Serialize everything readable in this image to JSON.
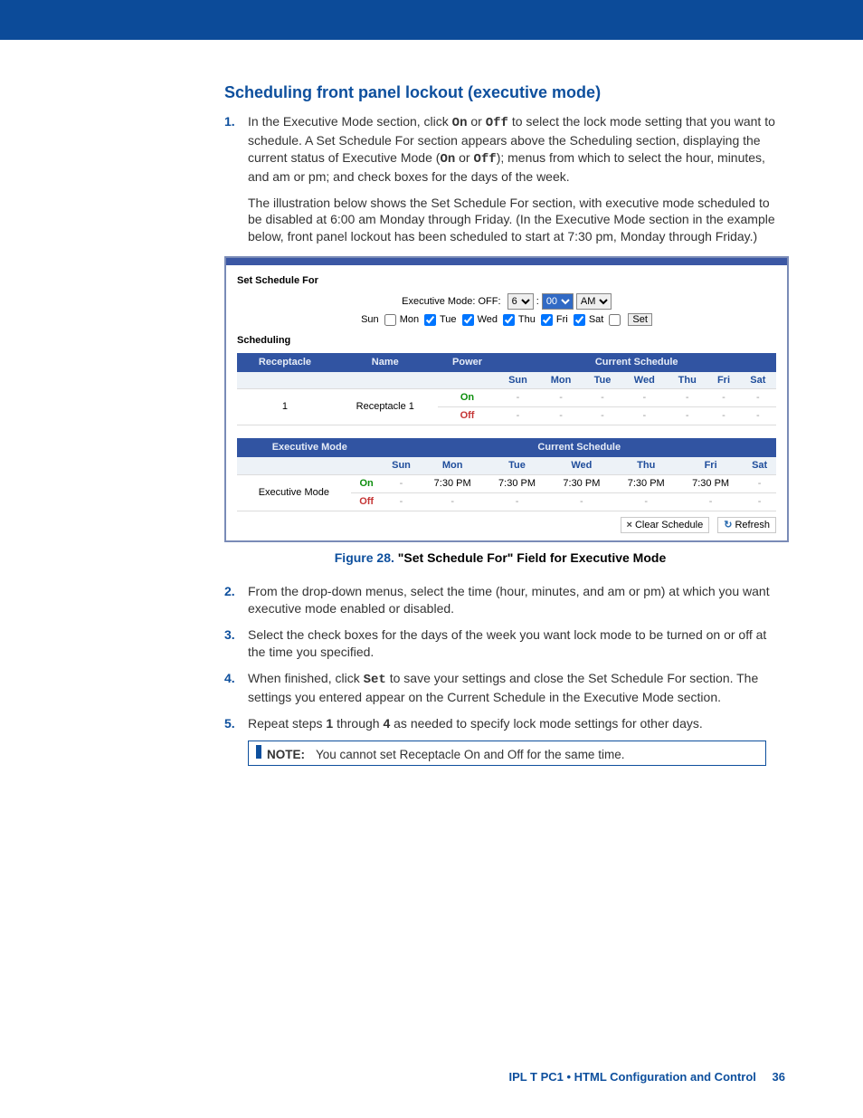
{
  "heading": "Scheduling front panel lockout (executive mode)",
  "steps": {
    "s1a": "In the Executive Mode section, click ",
    "s1_on": "On",
    "s1_mid": " or ",
    "s1_off": "Off",
    "s1b": " to select the lock mode setting that you want to schedule. A Set Schedule For section appears above the Scheduling section, displaying the current status of Executive Mode (",
    "s1_on2": "On",
    "s1_mid2": " or ",
    "s1_off2": "Off",
    "s1c": "); menus from which to select the hour, minutes, and am or pm; and check boxes for the days of the week.",
    "s1p2": "The illustration below shows the Set Schedule For section, with executive mode scheduled to be disabled at 6:00 am Monday through Friday. (In the Executive Mode section in the example below, front panel lockout has been scheduled to start at 7:30 pm, Monday through Friday.)",
    "s2": "From the drop-down menus, select the time (hour, minutes, and am or pm) at which you want executive mode enabled or disabled.",
    "s3": "Select the check boxes for the days of the week you want lock mode to be turned on or off at the time you specified.",
    "s4a": "When finished, click ",
    "s4_set": "Set",
    "s4b": " to save your settings and close the Set Schedule For section. The settings you entered appear on the Current Schedule in the Executive Mode section.",
    "s5a": "Repeat steps ",
    "s5_1": "1",
    "s5_mid": " through ",
    "s5_4": "4",
    "s5b": " as needed to specify lock mode settings for other days."
  },
  "shot": {
    "set_schedule_for": "Set Schedule For",
    "exec_mode_label": "Executive Mode: OFF:",
    "hour": "6",
    "colon": ":",
    "min": "00",
    "ampm": "AM",
    "days": [
      "Sun",
      "Mon",
      "Tue",
      "Wed",
      "Thu",
      "Fri",
      "Sat"
    ],
    "checked": [
      false,
      true,
      true,
      true,
      true,
      true,
      false
    ],
    "set": "Set",
    "scheduling": "Scheduling",
    "hdr_receptacle": "Receptacle",
    "hdr_name": "Name",
    "hdr_power": "Power",
    "hdr_cur": "Current Schedule",
    "daycols": [
      "Sun",
      "Mon",
      "Tue",
      "Wed",
      "Thu",
      "Fri",
      "Sat"
    ],
    "rec_num": "1",
    "rec_name": "Receptacle 1",
    "on": "On",
    "off": "Off",
    "exec_hdr": "Executive Mode",
    "exec_row": "Executive Mode",
    "on_times": [
      "-",
      "7:30 PM",
      "7:30 PM",
      "7:30 PM",
      "7:30 PM",
      "7:30 PM",
      "-"
    ],
    "clear": "Clear Schedule",
    "refresh": "Refresh"
  },
  "figure": {
    "lead": "Figure 28.",
    "rest": "  \"Set Schedule For\" Field for Executive Mode"
  },
  "note": {
    "label": "NOTE:",
    "text": "You cannot set Receptacle On and Off for the same time."
  },
  "footer": {
    "title": "IPL T PC1 • HTML Configuration and Control",
    "page": "36"
  }
}
